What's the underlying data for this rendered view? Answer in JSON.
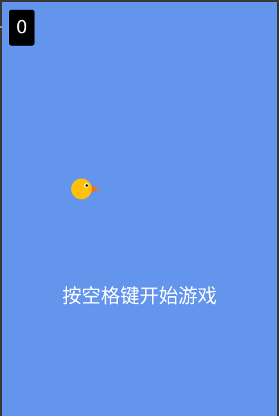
{
  "game": {
    "score": "0",
    "start_hint": "按空格键开始游戏",
    "background_color": "#6495ED",
    "bird": {
      "body_color": "#FFC107",
      "beak_color": "#FF6F00",
      "eye_color": "#000000"
    }
  },
  "icons": {
    "player": "bird-icon"
  }
}
